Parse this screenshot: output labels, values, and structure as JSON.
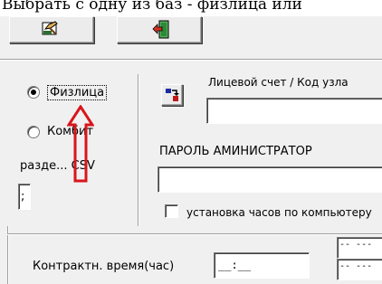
{
  "caption": "Выбрать с одну из баз - физлица или",
  "toolbar": {
    "buttons": [
      {
        "name": "edit-button",
        "icon": "hand-pencil-icon"
      },
      {
        "name": "exit-button",
        "icon": "exit-door-icon"
      }
    ]
  },
  "left_panel": {
    "radio_physical": {
      "label": "Физлица",
      "selected": true
    },
    "radio_company": {
      "label": "Комбит",
      "selected": false
    },
    "csv_separator_label": "разде... CSV",
    "csv_separator_value": ";"
  },
  "right_panel": {
    "account_label": "Лицевой счет / Код узла",
    "account_value": "",
    "admin_password_label": "ПАРОЛЬ АМИНИСТРАТОР",
    "admin_password_value": "",
    "clock_sync_label": "установка часов по компьютеру",
    "clock_sync_checked": false
  },
  "bottom": {
    "contract_time_label": "Контрактн. время(час)",
    "contract_time_value": "__:__",
    "mini_field_1": "-- ---",
    "mini_field_2": "-- ---"
  },
  "annotation": {
    "arrow_color": "#d9151b"
  }
}
